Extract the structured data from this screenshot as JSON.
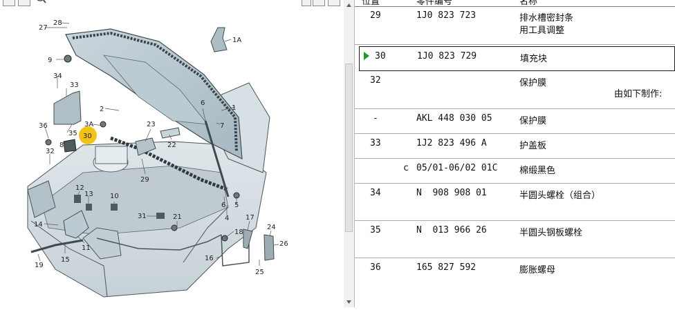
{
  "diagram": {
    "callouts": {
      "c1": "1",
      "c1a": "1A",
      "c2": "2",
      "c3a": "3A",
      "c4": "4",
      "c5": "5",
      "c6a": "6",
      "c6b": "6",
      "c7": "7",
      "c8": "8",
      "c9": "9",
      "c10": "10",
      "c11": "11",
      "c12": "12",
      "c13": "13",
      "c14": "14",
      "c15": "15",
      "c16": "16",
      "c17": "17",
      "c18": "18",
      "c19": "19",
      "c21": "21",
      "c22": "22",
      "c23": "23",
      "c24": "24",
      "c25": "25",
      "c26": "26",
      "c27": "27",
      "c28": "28",
      "c29": "29",
      "c30": "30",
      "c31": "31",
      "c32": "32",
      "c33": "33",
      "c34": "34",
      "c35": "35",
      "c36": "36"
    },
    "highlight_color": "#f2c21b"
  },
  "table": {
    "headers": {
      "position": "位置",
      "part_no": "零件编号",
      "name": "名称"
    },
    "rows": [
      {
        "pos": "29",
        "part": "1J0 823 723",
        "name": "排水槽密封条",
        "name2": "用工具调整"
      },
      {
        "pos": "30",
        "part": "1J0 823 729",
        "name": "填充块"
      },
      {
        "pos": "32",
        "part": "",
        "name": "保护膜",
        "note": "由如下制作:"
      },
      {
        "pos": "-",
        "part": "AKL 448 030 05",
        "name": "保护膜"
      },
      {
        "pos": "33",
        "part": "1J2 823 496 A",
        "name": "护盖板"
      },
      {
        "flag": "c",
        "part": "05/01-06/02 01C",
        "name": "棉缎黑色"
      },
      {
        "pos": "34",
        "part": "N  908 908 01",
        "name": "半圆头螺栓（组合）"
      },
      {
        "pos": "35",
        "part": "N  013 966 26",
        "name": "半圆头钢板螺栓"
      },
      {
        "pos": "36",
        "part": "165 827 592",
        "name": "膨胀螺母"
      }
    ],
    "selected_color": "#1c9a2a"
  }
}
